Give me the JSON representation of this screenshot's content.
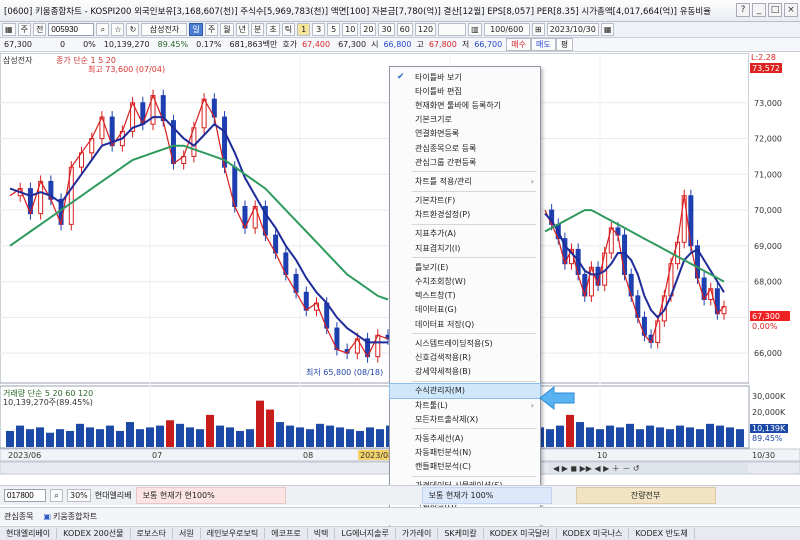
{
  "window": {
    "title": "[0600] 키움종합차트 - KOSPI200 외국인보유[3,168,607(천)] 주식수[5,969,783(천)] 액면[100] 자본금[7,780(억)] 결산[12월] EPS[8,057] PER[8.35] 시가총액[4,017,664(억)] 유동비율",
    "buttons": [
      "?",
      "_",
      "□",
      "×"
    ]
  },
  "toolbar": {
    "buttons": [
      "▦",
      "주",
      "전"
    ],
    "code": "005930",
    "stock_name": "삼성전자",
    "period_buttons": [
      "일",
      "주",
      "월",
      "년",
      "분",
      "초",
      "틱"
    ],
    "interval_buttons": [
      "1",
      "3",
      "5",
      "10",
      "20",
      "30",
      "60",
      "120"
    ],
    "count": "100/600",
    "date": "2023/10/30"
  },
  "quote": {
    "price": "67,300",
    "change": "0",
    "change_pct": "0%",
    "volume": "10,139,270",
    "turnover": "89.45%",
    "ratio": "0.17%",
    "amount": "681,863백만",
    "ask_label": "호가",
    "ask": "67,400",
    "bid": "67,300",
    "open_label": "시",
    "open": "66,800",
    "high_label": "고",
    "high": "67,800",
    "low_label": "저",
    "low": "66,700",
    "buy": "매수",
    "sell": "매도",
    "more": "평"
  },
  "chart": {
    "price_legend": "삼성전자",
    "ma_legend": "종가 단순 1 5 20",
    "high_note": "최고 73,600 (07/04)",
    "low_note": "최저 65,800 (08/18)",
    "top_right_label": "L:2.28",
    "top_right_value": "73,572",
    "price_axis": [
      "73,000",
      "72,000",
      "71,000",
      "70,000",
      "69,000",
      "68,000",
      "67,000",
      "66,000"
    ],
    "current_price_tag": "67,300",
    "current_pct_tag": "0.00%",
    "volume_legend": "거래량 단순 5 20 60 120",
    "volume_value": "10,139,270주(89.45%)",
    "volume_axis": [
      "30,000K",
      "20,000K",
      "10,000K"
    ],
    "volume_tag": "10,139K",
    "volume_pct": "89.45%",
    "x_labels": [
      "2023/06",
      "07",
      "08",
      "2023/08",
      "10",
      "10/30"
    ]
  },
  "chart_data": {
    "type": "line",
    "series": [
      {
        "name": "1",
        "color": "#d81e1e",
        "values": [
          70400,
          70600,
          69900,
          70800,
          70300,
          69600,
          71200,
          71600,
          72000,
          72600,
          71800,
          72200,
          73000,
          72400,
          73200,
          72500,
          71300,
          71500,
          72300,
          73100,
          72600,
          71200,
          70100,
          69500,
          70100,
          69300,
          68800,
          68200,
          67700,
          67200,
          67400,
          66700,
          66100,
          66000,
          66400,
          65900,
          66500,
          66400
        ]
      },
      {
        "name": "5",
        "color": "#1e2c9a",
        "values": [
          70600,
          70500,
          70400,
          70500,
          70400,
          70200,
          70600,
          71000,
          71400,
          71800,
          71900,
          72000,
          72300,
          72400,
          72600,
          72600,
          72300,
          72000,
          71800,
          72100,
          72400,
          72200,
          71600,
          70900,
          70400,
          69900,
          69500,
          69000,
          68600,
          68100,
          67700,
          67400,
          67000,
          66700,
          66500,
          66300,
          66300,
          66300
        ]
      },
      {
        "name": "20",
        "color": "#2f9a5e",
        "values": [
          69000,
          69200,
          69400,
          69600,
          69800,
          70000,
          70200,
          70400,
          70600,
          70800,
          71000,
          71200,
          71400,
          71500,
          71600,
          71700,
          71800,
          71800,
          71700,
          71600,
          71500,
          71400,
          71200,
          71000,
          70800,
          70600,
          70300,
          70000,
          69700,
          69400,
          69100,
          68800,
          68500,
          68200,
          68000,
          67800,
          67600,
          67500
        ]
      }
    ],
    "right_series": [
      {
        "name": "1",
        "values": [
          70000,
          69600,
          69200,
          68500,
          68900,
          68200,
          67600,
          68400,
          67900,
          68800,
          69500,
          69300,
          68200,
          67600,
          67000,
          66500,
          66300,
          66900,
          67600,
          68500,
          69100,
          70400,
          69000,
          68100,
          67500,
          67800,
          67100,
          67300
        ]
      },
      {
        "name": "5",
        "values": [
          69900,
          69700,
          69400,
          69000,
          68800,
          68600,
          68300,
          68200,
          68200,
          68300,
          68500,
          68800,
          68800,
          68600,
          68200,
          67600,
          67200,
          67000,
          67200,
          67600,
          68100,
          68600,
          68800,
          68900,
          68600,
          68300,
          68000,
          67700
        ]
      },
      {
        "name": "20",
        "values": [
          69400,
          69500,
          69600,
          69700,
          69800,
          69900,
          70000,
          70000,
          69900,
          69800,
          69700,
          69600,
          69500,
          69400,
          69300,
          69200,
          69100,
          69000,
          68900,
          68800,
          68700,
          68600,
          68500,
          68400,
          68300,
          68200,
          68100,
          68000
        ]
      }
    ],
    "volume": [
      9,
      12,
      10,
      11,
      8,
      10,
      9,
      13,
      11,
      10,
      12,
      9,
      14,
      10,
      11,
      12,
      15,
      13,
      11,
      10,
      18,
      12,
      11,
      9,
      10,
      26,
      21,
      14,
      12,
      11,
      10,
      13,
      12,
      11,
      10,
      9,
      11,
      10,
      12,
      9,
      10,
      12,
      11,
      13,
      14,
      10,
      11,
      9,
      12,
      10,
      11,
      13,
      12,
      11,
      10,
      12,
      18,
      14,
      11,
      10,
      12,
      11,
      13,
      10,
      12,
      11,
      10,
      12,
      11,
      10,
      13,
      12,
      11,
      10
    ],
    "ylim": [
      65500,
      74000
    ],
    "volume_ylim": [
      0,
      35
    ]
  },
  "context_menu": {
    "items": [
      {
        "label": "타이틀바 보기",
        "checked": true
      },
      {
        "label": "타이틀바 편집"
      },
      {
        "label": "현재화면 툴바에 등록하기"
      },
      {
        "label": "기본크기로"
      },
      {
        "label": "연결화면등록"
      },
      {
        "label": "관심종목으로 등록"
      },
      {
        "label": "관심그룹 간편등록",
        "sep_after": true
      },
      {
        "label": "차트틀 적용/관리",
        "submenu": true,
        "sep_after": true
      },
      {
        "label": "기본차트(F)"
      },
      {
        "label": "차트환경설정(P)",
        "sep_after": true
      },
      {
        "label": "지표추가(A)"
      },
      {
        "label": "지표겹치기(I)",
        "sep_after": true
      },
      {
        "label": "틀보기(E)"
      },
      {
        "label": "수치조회창(W)"
      },
      {
        "label": "텍스트창(T)"
      },
      {
        "label": "데이터표(G)"
      },
      {
        "label": "데이터표 저장(Q)",
        "sep_after": true
      },
      {
        "label": "시스템트레이딩적용(S)"
      },
      {
        "label": "신호검색적용(R)"
      },
      {
        "label": "강세약세적용(B)",
        "sep_after": true
      },
      {
        "label": "수식관리자(M)",
        "highlight": true
      },
      {
        "label": "차트툴(L)",
        "submenu": true
      },
      {
        "label": "모든차트출삭제(X)",
        "sep_after": true
      },
      {
        "label": "자동추세선(A)"
      },
      {
        "label": "자동패턴분석(N)"
      },
      {
        "label": "캔들패턴분석(C)",
        "sep_after": true
      },
      {
        "label": "가격데이터 시뮬레이션(S)",
        "sep_after": true
      },
      {
        "label": "그림저장(D)"
      },
      {
        "label": "화면인쇄(H)"
      }
    ]
  },
  "bottom": {
    "code": "017800",
    "pct": "30%",
    "name": "현대엘리베",
    "left_box": "보통  현재가  현100%",
    "mid_box": "보통  현재가  100%",
    "right_box": "잔량전부",
    "tabs": [
      "관심종목",
      "키움종합차트"
    ],
    "ticker": [
      "현대엘리베이",
      "KODEX 200선물",
      "로보스타",
      "서원",
      "레인보우로보틱",
      "에코프로",
      "빅텍",
      "LG에너지솔루",
      "가가레이",
      "SK케미칼",
      "KODEX 미국달러",
      "KODEX 미국나스",
      "KODEX 반도체"
    ]
  }
}
